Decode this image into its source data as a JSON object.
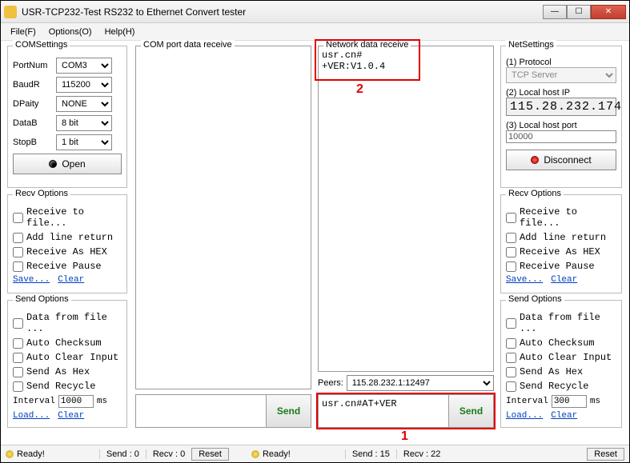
{
  "window": {
    "title": "USR-TCP232-Test  RS232 to Ethernet Convert tester"
  },
  "menu": {
    "file": "File(F)",
    "options": "Options(O)",
    "help": "Help(H)"
  },
  "com_settings": {
    "title": "COMSettings",
    "portnum_label": "PortNum",
    "portnum": "COM3",
    "baud_label": "BaudR",
    "baud": "115200",
    "parity_label": "DPaity",
    "parity": "NONE",
    "datab_label": "DataB",
    "datab": "8 bit",
    "stopb_label": "StopB",
    "stopb": "1 bit",
    "open_label": "Open"
  },
  "net_settings": {
    "title": "NetSettings",
    "proto_label": "(1) Protocol",
    "proto": "TCP Server",
    "ip_label": "(2) Local host IP",
    "ip": "115.28.232.174",
    "port_label": "(3) Local host port",
    "port": "10000",
    "disconnect_label": "Disconnect"
  },
  "recv_opts": {
    "title": "Recv Options",
    "to_file": "Receive to file...",
    "add_line": "Add line return",
    "as_hex": "Receive As HEX",
    "pause": "Receive Pause",
    "save": "Save...",
    "clear": "Clear"
  },
  "send_opts": {
    "title": "Send Options",
    "from_file": "Data from file ...",
    "checksum": "Auto Checksum",
    "clear_input": "Auto Clear Input",
    "as_hex": "Send As Hex",
    "recycle": "Send Recycle",
    "interval_label": "Interval",
    "interval_com": "1000",
    "interval_net": "300",
    "ms": "ms",
    "load": "Load...",
    "clear": "Clear"
  },
  "com_recv": {
    "title": "COM port data receive",
    "body": ""
  },
  "net_recv": {
    "title": "Network data receive",
    "body": "usr.cn#\n+VER:V1.0.4"
  },
  "peers": {
    "label": "Peers:",
    "value": "115.28.232.1:12497"
  },
  "send": {
    "com_value": "",
    "net_value": "usr.cn#AT+VER",
    "button": "Send"
  },
  "status": {
    "ready": "Ready!",
    "com_send": "Send : 0",
    "com_recv": "Recv : 0",
    "net_send": "Send : 15",
    "net_recv": "Recv : 22",
    "reset": "Reset"
  },
  "annotations": {
    "label1": "1",
    "label2": "2"
  }
}
